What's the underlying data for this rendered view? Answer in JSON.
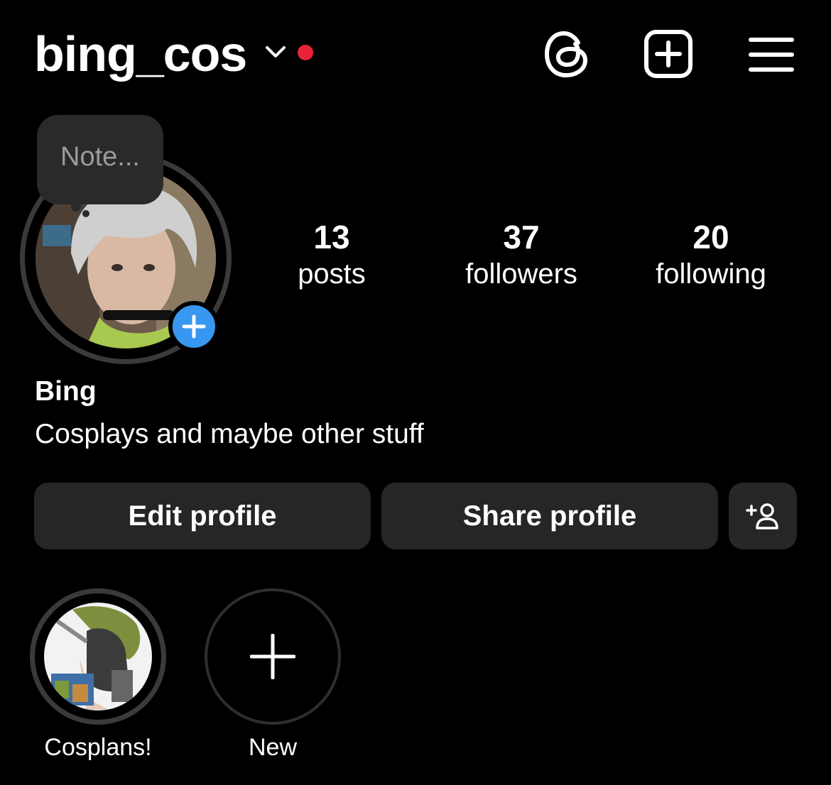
{
  "header": {
    "username": "bing_cos",
    "account_switcher_icon": "chevron-down-icon",
    "notification_dot_color": "#e8233a",
    "actions": [
      "threads-icon",
      "new-post-icon",
      "menu-icon"
    ]
  },
  "note": {
    "placeholder": "Note..."
  },
  "profile": {
    "add_story_color": "#3897f0",
    "stats": [
      {
        "value": "13",
        "label": "posts"
      },
      {
        "value": "37",
        "label": "followers"
      },
      {
        "value": "20",
        "label": "following"
      }
    ],
    "name": "Bing",
    "bio": "Cosplays and maybe other stuff"
  },
  "buttons": {
    "edit": "Edit profile",
    "share": "Share profile",
    "discover_icon": "add-person-icon"
  },
  "highlights": [
    {
      "label": "Cosplans!"
    },
    {
      "label": "New"
    }
  ]
}
